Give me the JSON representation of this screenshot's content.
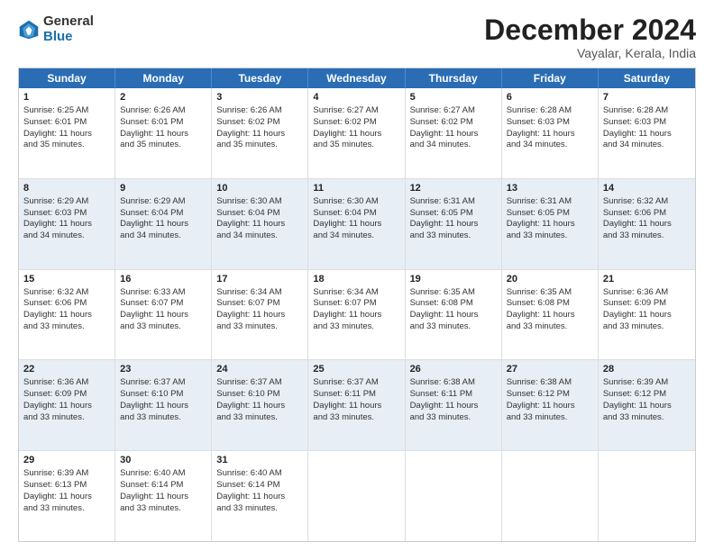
{
  "logo": {
    "general": "General",
    "blue": "Blue"
  },
  "title": {
    "month_year": "December 2024",
    "location": "Vayalar, Kerala, India"
  },
  "header_days": [
    "Sunday",
    "Monday",
    "Tuesday",
    "Wednesday",
    "Thursday",
    "Friday",
    "Saturday"
  ],
  "weeks": [
    {
      "row_class": "row-0",
      "cells": [
        {
          "day": "1",
          "lines": [
            "Sunrise: 6:25 AM",
            "Sunset: 6:01 PM",
            "Daylight: 11 hours",
            "and 35 minutes."
          ]
        },
        {
          "day": "2",
          "lines": [
            "Sunrise: 6:26 AM",
            "Sunset: 6:01 PM",
            "Daylight: 11 hours",
            "and 35 minutes."
          ]
        },
        {
          "day": "3",
          "lines": [
            "Sunrise: 6:26 AM",
            "Sunset: 6:02 PM",
            "Daylight: 11 hours",
            "and 35 minutes."
          ]
        },
        {
          "day": "4",
          "lines": [
            "Sunrise: 6:27 AM",
            "Sunset: 6:02 PM",
            "Daylight: 11 hours",
            "and 35 minutes."
          ]
        },
        {
          "day": "5",
          "lines": [
            "Sunrise: 6:27 AM",
            "Sunset: 6:02 PM",
            "Daylight: 11 hours",
            "and 34 minutes."
          ]
        },
        {
          "day": "6",
          "lines": [
            "Sunrise: 6:28 AM",
            "Sunset: 6:03 PM",
            "Daylight: 11 hours",
            "and 34 minutes."
          ]
        },
        {
          "day": "7",
          "lines": [
            "Sunrise: 6:28 AM",
            "Sunset: 6:03 PM",
            "Daylight: 11 hours",
            "and 34 minutes."
          ]
        }
      ]
    },
    {
      "row_class": "row-1",
      "cells": [
        {
          "day": "8",
          "lines": [
            "Sunrise: 6:29 AM",
            "Sunset: 6:03 PM",
            "Daylight: 11 hours",
            "and 34 minutes."
          ]
        },
        {
          "day": "9",
          "lines": [
            "Sunrise: 6:29 AM",
            "Sunset: 6:04 PM",
            "Daylight: 11 hours",
            "and 34 minutes."
          ]
        },
        {
          "day": "10",
          "lines": [
            "Sunrise: 6:30 AM",
            "Sunset: 6:04 PM",
            "Daylight: 11 hours",
            "and 34 minutes."
          ]
        },
        {
          "day": "11",
          "lines": [
            "Sunrise: 6:30 AM",
            "Sunset: 6:04 PM",
            "Daylight: 11 hours",
            "and 34 minutes."
          ]
        },
        {
          "day": "12",
          "lines": [
            "Sunrise: 6:31 AM",
            "Sunset: 6:05 PM",
            "Daylight: 11 hours",
            "and 33 minutes."
          ]
        },
        {
          "day": "13",
          "lines": [
            "Sunrise: 6:31 AM",
            "Sunset: 6:05 PM",
            "Daylight: 11 hours",
            "and 33 minutes."
          ]
        },
        {
          "day": "14",
          "lines": [
            "Sunrise: 6:32 AM",
            "Sunset: 6:06 PM",
            "Daylight: 11 hours",
            "and 33 minutes."
          ]
        }
      ]
    },
    {
      "row_class": "row-2",
      "cells": [
        {
          "day": "15",
          "lines": [
            "Sunrise: 6:32 AM",
            "Sunset: 6:06 PM",
            "Daylight: 11 hours",
            "and 33 minutes."
          ]
        },
        {
          "day": "16",
          "lines": [
            "Sunrise: 6:33 AM",
            "Sunset: 6:07 PM",
            "Daylight: 11 hours",
            "and 33 minutes."
          ]
        },
        {
          "day": "17",
          "lines": [
            "Sunrise: 6:34 AM",
            "Sunset: 6:07 PM",
            "Daylight: 11 hours",
            "and 33 minutes."
          ]
        },
        {
          "day": "18",
          "lines": [
            "Sunrise: 6:34 AM",
            "Sunset: 6:07 PM",
            "Daylight: 11 hours",
            "and 33 minutes."
          ]
        },
        {
          "day": "19",
          "lines": [
            "Sunrise: 6:35 AM",
            "Sunset: 6:08 PM",
            "Daylight: 11 hours",
            "and 33 minutes."
          ]
        },
        {
          "day": "20",
          "lines": [
            "Sunrise: 6:35 AM",
            "Sunset: 6:08 PM",
            "Daylight: 11 hours",
            "and 33 minutes."
          ]
        },
        {
          "day": "21",
          "lines": [
            "Sunrise: 6:36 AM",
            "Sunset: 6:09 PM",
            "Daylight: 11 hours",
            "and 33 minutes."
          ]
        }
      ]
    },
    {
      "row_class": "row-3",
      "cells": [
        {
          "day": "22",
          "lines": [
            "Sunrise: 6:36 AM",
            "Sunset: 6:09 PM",
            "Daylight: 11 hours",
            "and 33 minutes."
          ]
        },
        {
          "day": "23",
          "lines": [
            "Sunrise: 6:37 AM",
            "Sunset: 6:10 PM",
            "Daylight: 11 hours",
            "and 33 minutes."
          ]
        },
        {
          "day": "24",
          "lines": [
            "Sunrise: 6:37 AM",
            "Sunset: 6:10 PM",
            "Daylight: 11 hours",
            "and 33 minutes."
          ]
        },
        {
          "day": "25",
          "lines": [
            "Sunrise: 6:37 AM",
            "Sunset: 6:11 PM",
            "Daylight: 11 hours",
            "and 33 minutes."
          ]
        },
        {
          "day": "26",
          "lines": [
            "Sunrise: 6:38 AM",
            "Sunset: 6:11 PM",
            "Daylight: 11 hours",
            "and 33 minutes."
          ]
        },
        {
          "day": "27",
          "lines": [
            "Sunrise: 6:38 AM",
            "Sunset: 6:12 PM",
            "Daylight: 11 hours",
            "and 33 minutes."
          ]
        },
        {
          "day": "28",
          "lines": [
            "Sunrise: 6:39 AM",
            "Sunset: 6:12 PM",
            "Daylight: 11 hours",
            "and 33 minutes."
          ]
        }
      ]
    },
    {
      "row_class": "row-4",
      "cells": [
        {
          "day": "29",
          "lines": [
            "Sunrise: 6:39 AM",
            "Sunset: 6:13 PM",
            "Daylight: 11 hours",
            "and 33 minutes."
          ]
        },
        {
          "day": "30",
          "lines": [
            "Sunrise: 6:40 AM",
            "Sunset: 6:14 PM",
            "Daylight: 11 hours",
            "and 33 minutes."
          ]
        },
        {
          "day": "31",
          "lines": [
            "Sunrise: 6:40 AM",
            "Sunset: 6:14 PM",
            "Daylight: 11 hours",
            "and 33 minutes."
          ]
        },
        {
          "day": "",
          "lines": []
        },
        {
          "day": "",
          "lines": []
        },
        {
          "day": "",
          "lines": []
        },
        {
          "day": "",
          "lines": []
        }
      ]
    }
  ]
}
